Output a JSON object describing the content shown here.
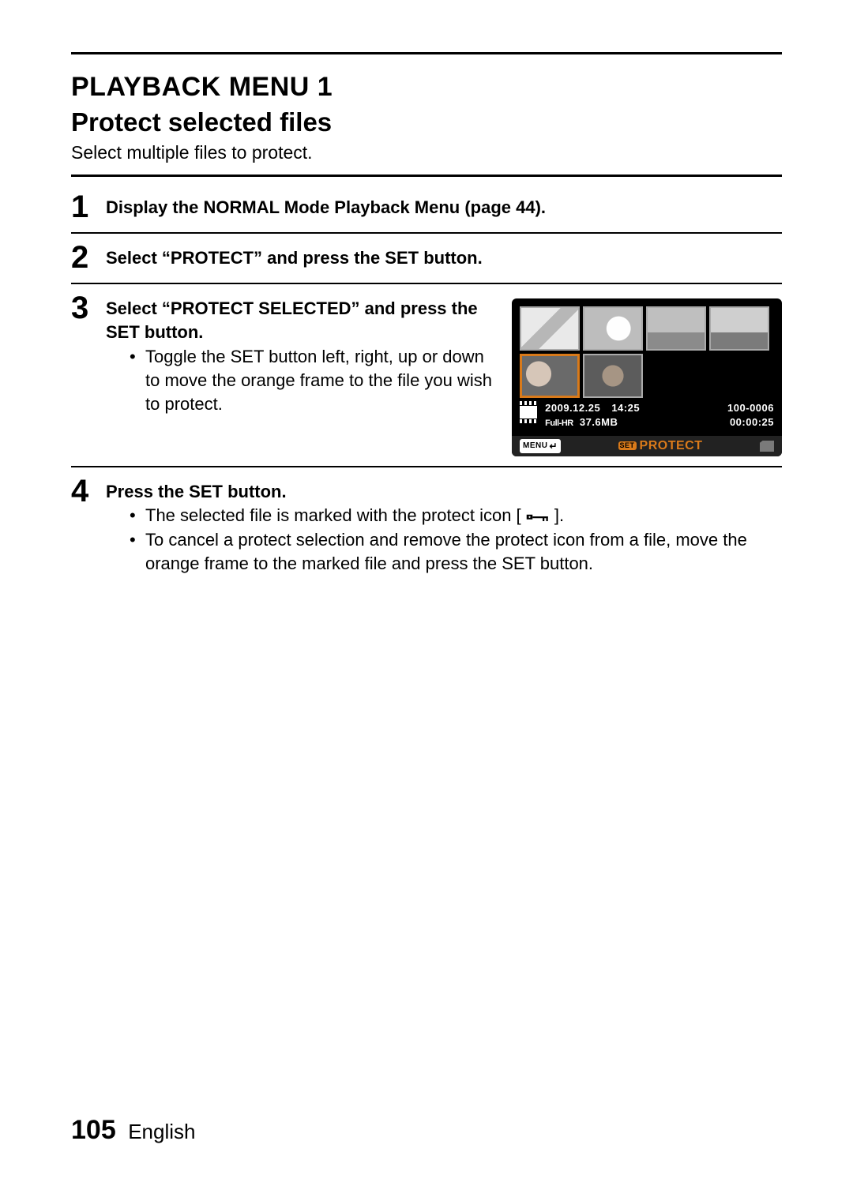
{
  "header": {
    "title": "PLAYBACK MENU 1",
    "subtitle": "Protect selected files",
    "lead": "Select multiple files to protect."
  },
  "steps": {
    "s1": {
      "num": "1",
      "title": "Display the NORMAL Mode Playback Menu (page 44)."
    },
    "s2": {
      "num": "2",
      "title": "Select “PROTECT” and press the SET button."
    },
    "s3": {
      "num": "3",
      "title": "Select “PROTECT SELECTED” and press the SET button.",
      "bullet1": "Toggle the SET button left, right, up or down to move the orange frame to the file you wish to protect."
    },
    "s4": {
      "num": "4",
      "title": "Press the SET button.",
      "bullet1_a": "The selected file is marked with the protect icon [",
      "bullet1_b": "].",
      "bullet2": "To cancel a protect selection and remove the protect icon from a file, move the orange frame to the marked file and press the SET button."
    }
  },
  "screen": {
    "date": "2009.12.25",
    "time": "14:25",
    "file_no": "100-0006",
    "mode": "Full-HR",
    "size": "37.6MB",
    "duration": "00:00:25",
    "menu_label": "MENU",
    "set_label": "SET",
    "protect_label": "PROTECT"
  },
  "footer": {
    "page": "105",
    "lang": "English"
  }
}
